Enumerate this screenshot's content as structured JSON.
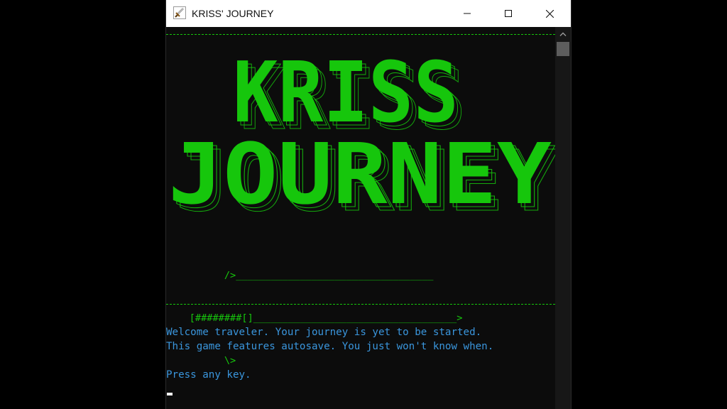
{
  "window": {
    "title": "KRISS' JOURNEY",
    "icon": "sword-icon"
  },
  "controls": {
    "minimize_icon": "minimize-icon",
    "maximize_icon": "maximize-icon",
    "close_icon": "close-icon"
  },
  "console": {
    "logo_lines": [
      "KRISS",
      "JOURNEY"
    ],
    "sword_art": [
      "          />__________________________________",
      "    [########[]___________________________________>",
      "          \\>"
    ],
    "messages": [
      "Welcome traveler. Your journey is yet to be started.",
      "This game features autosave. You just won't know when.",
      "Press any key."
    ]
  },
  "colors": {
    "title_green": "#16c60c",
    "message_blue": "#3a96dd",
    "background": "#0c0c0c"
  }
}
